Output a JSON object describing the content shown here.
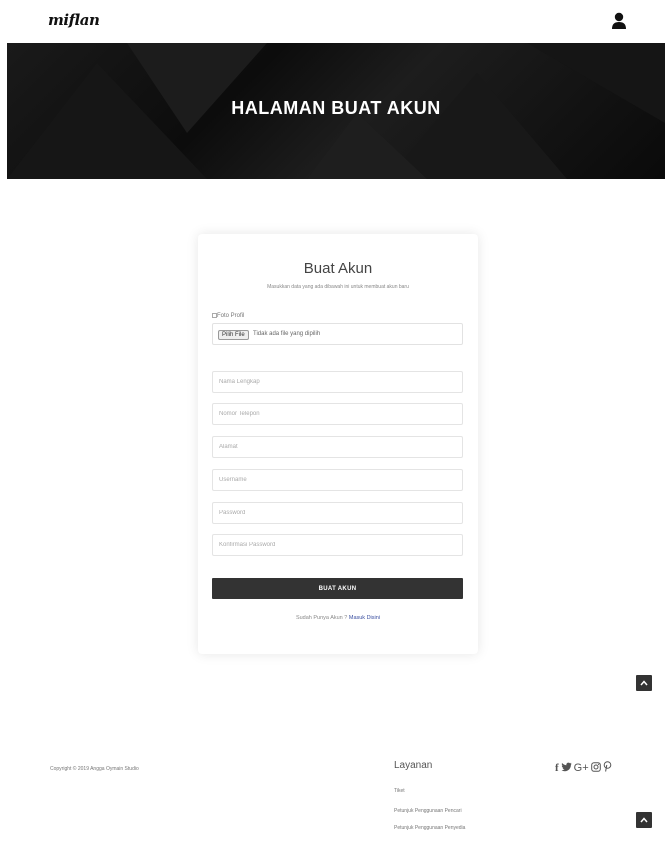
{
  "header": {
    "logo_text": "miflan"
  },
  "hero": {
    "title": "HALAMAN BUAT AKUN"
  },
  "form": {
    "title": "Buat Akun",
    "subtitle": "Masukkan data yang ada dibawah ini untuk membuat akun baru",
    "photo_alt": "Foto Profil",
    "file_button_label": "Pilih File",
    "file_status": "Tidak ada file yang dipilih",
    "fields": {
      "nama_lengkap": "Nama Lengkap",
      "nomor_telepon": "Nomor Telepon",
      "alamat": "Alamat",
      "username": "Username",
      "password": "Password",
      "konfirmasi_password": "Konfirmasi Password"
    },
    "submit_label": "BUAT AKUN",
    "login_prompt": "Sudah Punya Akun ? ",
    "login_link": "Masuk Disini"
  },
  "footer": {
    "copyright": "Copyright © 2019 Angga Oymain Studio",
    "layanan_title": "Layanan",
    "links": [
      "Tiket",
      "Petunjuk Penggunaan Pencari",
      "Petunjuk Penggunaan Penyedia"
    ],
    "social_icons": [
      "facebook-icon",
      "twitter-icon",
      "google-plus-icon",
      "instagram-icon",
      "pinterest-icon"
    ]
  },
  "colors": {
    "hero_bg": "#111111",
    "button_bg": "#333333",
    "link": "#3b4fa0"
  }
}
